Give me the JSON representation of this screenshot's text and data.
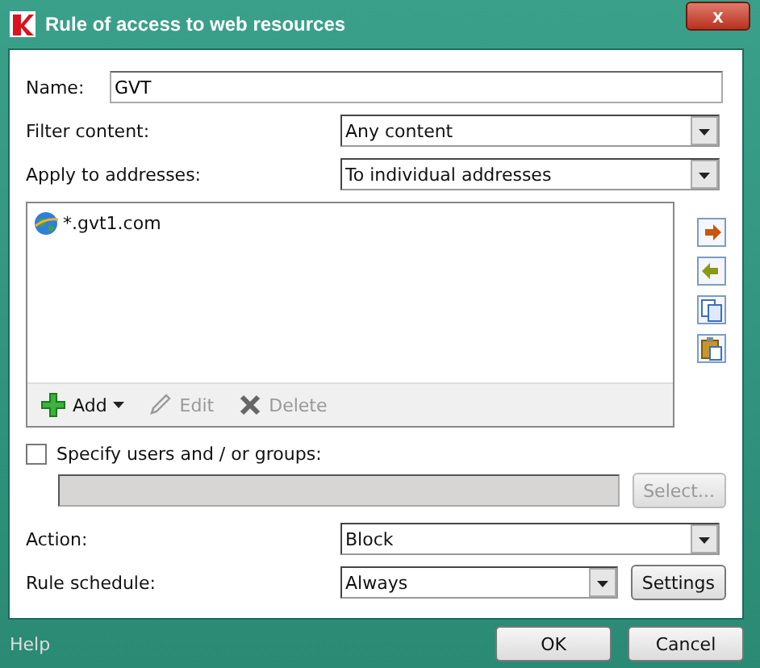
{
  "window": {
    "title": "Rule of access to web resources",
    "close": "x"
  },
  "name": {
    "label": "Name:",
    "value": "GVT"
  },
  "filter_content": {
    "label": "Filter content:",
    "value": "Any content"
  },
  "apply_to": {
    "label": "Apply to addresses:",
    "value": "To individual addresses"
  },
  "addresses": [
    {
      "text": "*.gvt1.com",
      "selected": false
    }
  ],
  "list_toolbar": [
    {
      "kind": "add",
      "label": "Add",
      "disabled": false
    },
    {
      "kind": "edit",
      "label": "Edit",
      "disabled": true
    },
    {
      "kind": "delete",
      "label": "Delete",
      "disabled": true
    }
  ],
  "side_buttons": [
    {
      "kind": "export"
    },
    {
      "kind": "import"
    },
    {
      "kind": "copy"
    },
    {
      "kind": "paste"
    }
  ],
  "users": {
    "label": "Specify users and / or groups:",
    "checked": false,
    "button": "Select...",
    "disabled": true
  },
  "action": {
    "label": "Action:",
    "value": "Block"
  },
  "schedule": {
    "label": "Rule schedule:",
    "value": "Always",
    "button": "Settings"
  },
  "footer": {
    "help": "Help",
    "buttons": [
      "OK",
      "Cancel"
    ]
  }
}
